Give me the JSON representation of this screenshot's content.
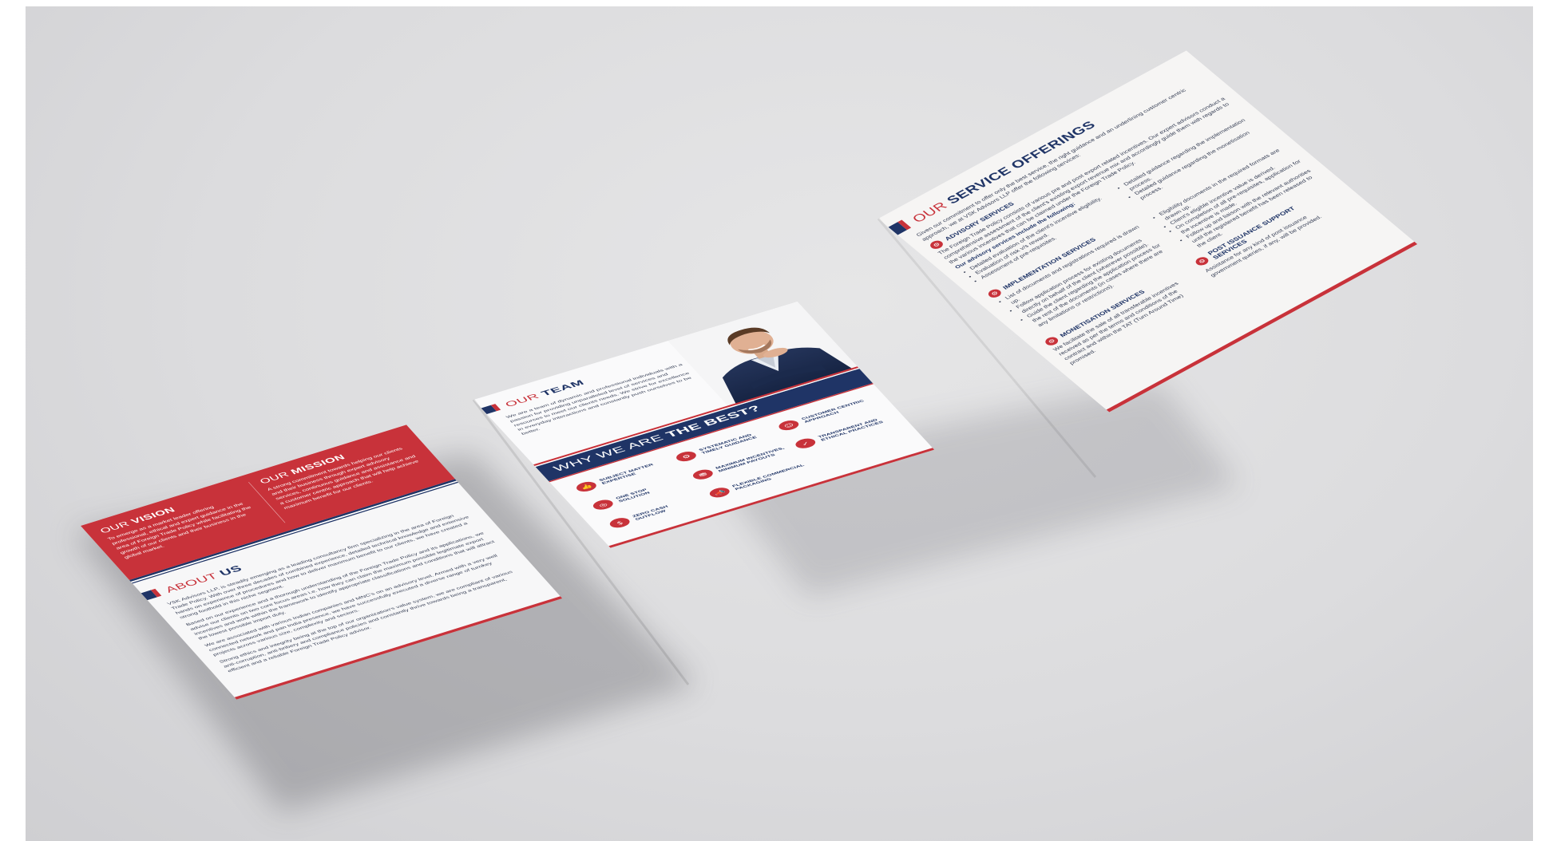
{
  "colors": {
    "navy": "#1f3466",
    "red": "#c8323a",
    "paper": "#f7f7f8",
    "background": "#dcdcde"
  },
  "left_panel": {
    "vision": {
      "pre": "OUR",
      "main": "VISION",
      "text": "To emerge as a market leader offering professional, ethical and expert guidance in the area of Foreign Trade Policy while facilitating the growth of our clients and their business in the global market."
    },
    "mission": {
      "pre": "OUR",
      "main": "MISSION",
      "text": "A strong commitment towards helping our clients and their business through expert advisory services, continuous guidance and assistance and a customer centric approach that will help achieve maximum benefit for our clients."
    },
    "about": {
      "pre": "ABOUT",
      "main": "US",
      "paragraphs": [
        "VSK Advisors LLP, is steadily emerging as a leading consultancy firm specializing in the area of Foreign Trade Policy. With over three decades of combined experience, detailed technical knowledge and extensive hands on experience of procedures and how to deliver maximum benefit to our clients, we have created a strong foothold in this niche segment.",
        "Based on our experience and a thorough understanding of the Foreign Trade Policy and its applications, we advise our clients on two core focus areas i.e. how they can claim the maximum possible legitimate export incentives and work within the framework to identify appropriate classifications and conditions that will attract the lowest possible import duty.",
        "We are associated with various Indian companies and MNC's on an advisory level. Armed with a very well connected network and pan India presence, we have successfully executed a diverse range of turnkey projects across various size, complexity and sectors.",
        "Strong ethics and integrity being at the top of our organization's value system, we are compliant of various anti-corruption, anti-bribery and compliance policies and constantly thrive towards being a transparent, efficient and a reliable Foreign Trade Policy advisor."
      ]
    }
  },
  "middle_panel": {
    "team": {
      "pre": "OUR",
      "main": "TEAM",
      "text": "We are a team of dynamic and professional individuals with a passion for providing unparalleled level of services and resources to meet our clients needs. We strive for excellence in everyday interactions and constantly push ourselves to be better."
    },
    "why": {
      "pre": "WHY WE ARE",
      "main": "THE BEST?"
    },
    "features": [
      {
        "icon": "thumbs-up-icon",
        "glyph": "👍",
        "label": "SUBJECT MATTER\nEXPERTISE"
      },
      {
        "icon": "handshake-icon",
        "glyph": "⚙",
        "label": "SYSTEMATIC AND\nTIMELY GUIDANCE"
      },
      {
        "icon": "customer-icon",
        "glyph": "☺",
        "label": "CUSTOMER CENTRIC\nAPPROACH"
      },
      {
        "icon": "target-icon",
        "glyph": "◎",
        "label": "ONE STOP\nSOLUTION"
      },
      {
        "icon": "coins-icon",
        "glyph": "⛃",
        "label": "MAXIMUM INCENTIVES,\nMINIMUM PAYOUTS"
      },
      {
        "icon": "checkmark-icon",
        "glyph": "✓",
        "label": "TRANSPARENT AND\nETHICAL PRACTICES"
      },
      {
        "icon": "cash-icon",
        "glyph": "$",
        "label": "ZERO CASH\nOUTFLOW"
      },
      {
        "icon": "megaphone-icon",
        "glyph": "📣",
        "label": "FLEXIBLE COMMERCIAL\nPACKAGING"
      }
    ]
  },
  "right_panel": {
    "title": {
      "pre": "OUR",
      "main": "SERVICE OFFERINGS"
    },
    "intro": "Given our commitment to offer only the best service, the right guidance and an underlining customer centric approach, we at VSK Advisors LLP offer the following services:",
    "advisory": {
      "title": "ADVISORY SERVICES",
      "text": "The Foreign Trade Policy consists of various pre and post export related incentives. Our expert advisors conduct a comprehensive assessment of the client's existing export revenue mix and accordingly guide them with regards to the various incentives that can be claimed under the Foreign Trade Policy.",
      "bold": "Our advisory services include the following:",
      "items_left": [
        "Detailed evaluation of the client's incentive eligibility.",
        "Evaluation of risk v/s reward.",
        "Assessment of pre-requisites."
      ],
      "items_right": [
        "Detailed guidance regarding the implementation process.",
        "Detailed guidance regarding the monetisation process."
      ]
    },
    "implementation": {
      "title": "IMPLEMENTATION SERVICES",
      "items_left": [
        "List of documents and registrations required is drawn up.",
        "Follow application process for existing documents directly on behalf of the client (wherever possible).",
        "Guide the client regarding the application process for the rest of the documents (in cases where there are any limitations or restrictions)."
      ],
      "items_right": [
        "Eligibility documents in the required formats are drawn up.",
        "Client's eligible incentive value is derived.",
        "On completion of all pre-requisites, application for the incentive is made.",
        "Follow up and liaison with the relevant authorities until the registered benefit has been released to the client."
      ]
    },
    "monetisation": {
      "title": "MONETISATION SERVICES",
      "text": "We facilitate the sale of all transferable incentives received as per the terms and conditions of the contract and within the TAT (Turn Around Time) promised."
    },
    "post_issuance": {
      "title": "POST ISSUANCE SUPPORT SERVICES",
      "text": "Assistance for any kind of post issuance government queries, if any, will be provided."
    }
  }
}
